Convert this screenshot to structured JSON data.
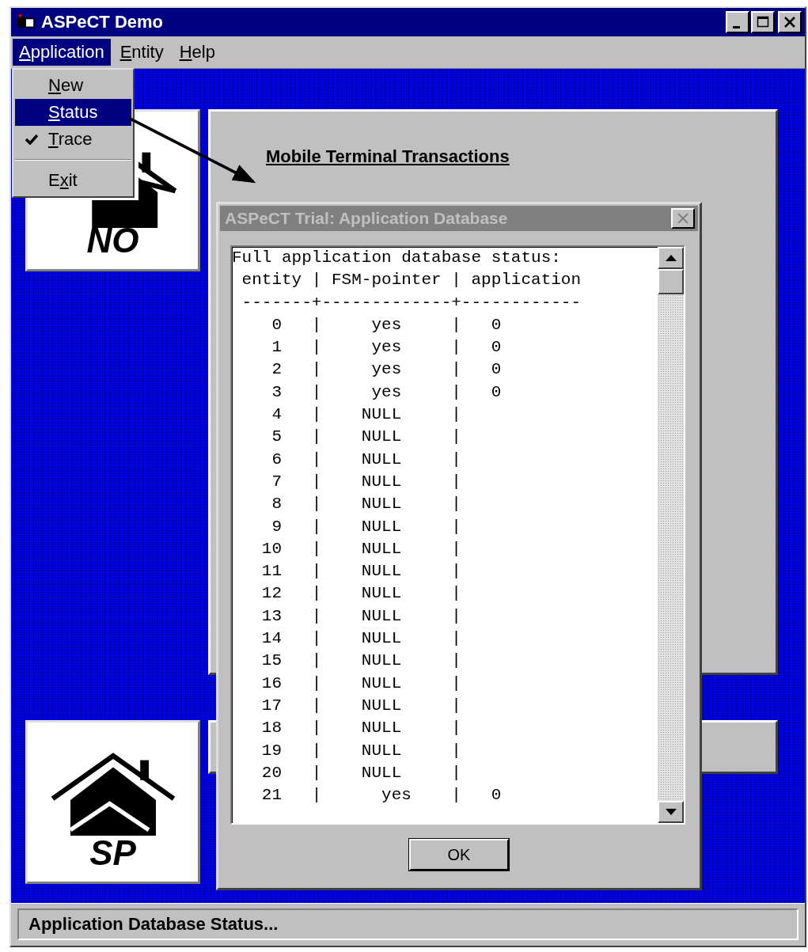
{
  "window": {
    "title": "ASPeCT Demo"
  },
  "menu_bar": [
    {
      "key": "A",
      "rest": "pplication",
      "selected": true
    },
    {
      "key": "E",
      "rest": "ntity",
      "selected": false
    },
    {
      "key": "H",
      "rest": "elp",
      "selected": false
    }
  ],
  "dropdown": [
    {
      "kind": "item",
      "key": "N",
      "rest": "ew",
      "selected": false,
      "checked": false
    },
    {
      "kind": "item",
      "key": "S",
      "rest": "tatus",
      "selected": true,
      "checked": false
    },
    {
      "kind": "item",
      "key": "T",
      "rest": "race",
      "selected": false,
      "checked": true
    },
    {
      "kind": "separator"
    },
    {
      "kind": "item",
      "pre": "E",
      "key": "x",
      "rest": "it",
      "selected": false,
      "checked": false
    }
  ],
  "logos": [
    {
      "text": "NO"
    },
    {
      "text": "SP"
    }
  ],
  "panel": {
    "title": "Mobile Terminal Transactions"
  },
  "dialog": {
    "title": "ASPeCT Trial: Application Database",
    "lines": [
      "Full application database status:",
      " entity | FSM-pointer | application",
      " -------+-------------+------------",
      "    0   |     yes     |   0",
      "    1   |     yes     |   0",
      "    2   |     yes     |   0",
      "    3   |     yes     |   0",
      "    4   |    NULL     |",
      "    5   |    NULL     |",
      "    6   |    NULL     |",
      "    7   |    NULL     |",
      "    8   |    NULL     |",
      "    9   |    NULL     |",
      "   10   |    NULL     |",
      "   11   |    NULL     |",
      "   12   |    NULL     |",
      "   13   |    NULL     |",
      "   14   |    NULL     |",
      "   15   |    NULL     |",
      "   16   |    NULL     |",
      "   17   |    NULL     |",
      "   18   |    NULL     |",
      "   19   |    NULL     |",
      "   20   |    NULL     |",
      "   21   |      yes    |   0"
    ],
    "button": "OK"
  },
  "status_bar": {
    "text": "Application Database Status..."
  }
}
